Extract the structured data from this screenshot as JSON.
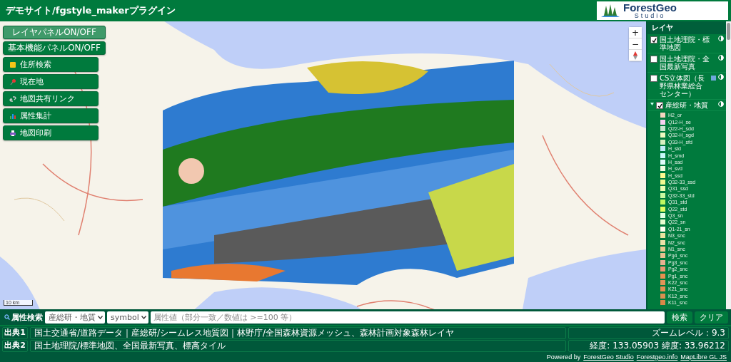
{
  "header": {
    "title": "デモサイト/fgstyle_makerプラグイン",
    "logo": {
      "name": "ForestGeo",
      "sub": "Studio"
    }
  },
  "left_buttons": [
    {
      "kind": "toggle",
      "label": "レイヤパネルON/OFF",
      "selected": true
    },
    {
      "kind": "toggle",
      "label": "基本機能パネルON/OFF",
      "selected": false
    },
    {
      "kind": "address",
      "label": "住所検索",
      "selected": false
    },
    {
      "kind": "location",
      "label": "現在地",
      "selected": false
    },
    {
      "kind": "link",
      "label": "地図共有リンク",
      "selected": false
    },
    {
      "kind": "stats",
      "label": "属性集計",
      "selected": false
    },
    {
      "kind": "print",
      "label": "地図印刷",
      "selected": false
    }
  ],
  "map": {
    "scale": "10 km",
    "controls": [
      "+",
      "−"
    ]
  },
  "layer_panel": {
    "title": "レイヤ",
    "layers": [
      {
        "name": "国土地理院・標準地図",
        "checked": true,
        "expanded": false
      },
      {
        "name": "国土地理院・全国最新写真",
        "checked": false,
        "expanded": false
      },
      {
        "name": "CS立体図（長野県林業総合センター）",
        "checked": false,
        "expanded": false,
        "color": "#6fa8dc"
      },
      {
        "name": "産総研・地質",
        "checked": true,
        "expanded": true
      }
    ],
    "legend": [
      {
        "label": "H2_or",
        "color": "#f5d5c0"
      },
      {
        "label": "Q12-H_se",
        "color": "#f7d0f0"
      },
      {
        "label": "Q22-H_sdd",
        "color": "#c8e6d0"
      },
      {
        "label": "Q32-H_sgd",
        "color": "#eef8c0"
      },
      {
        "label": "Q33-H_sfd",
        "color": "#d8f0c0"
      },
      {
        "label": "H_sld",
        "color": "#c0ecf8"
      },
      {
        "label": "H_smd",
        "color": "#c8f8f8"
      },
      {
        "label": "H_sad",
        "color": "#e0fafa"
      },
      {
        "label": "H_svd",
        "color": "#f0fce0"
      },
      {
        "label": "H_ssd",
        "color": "#fff890"
      },
      {
        "label": "Q32-33_ssd",
        "color": "#f0f890"
      },
      {
        "label": "Q31_ssd",
        "color": "#e8fcb0"
      },
      {
        "label": "Q32-33_std",
        "color": "#c8f8a0"
      },
      {
        "label": "Q31_std",
        "color": "#c0f860"
      },
      {
        "label": "Q22_std",
        "color": "#e0fc60"
      },
      {
        "label": "Q3_sn",
        "color": "#e0ffe0"
      },
      {
        "label": "Q22_sn",
        "color": "#e8fcd0"
      },
      {
        "label": "Q1-21_sn",
        "color": "#fffff0"
      },
      {
        "label": "N3_snc",
        "color": "#e8e4a0"
      },
      {
        "label": "N2_snc",
        "color": "#ece0a8"
      },
      {
        "label": "N1_snc",
        "color": "#e8c890"
      },
      {
        "label": "Pg4_snc",
        "color": "#e8c090"
      },
      {
        "label": "Pg3_snc",
        "color": "#e8b090"
      },
      {
        "label": "Pg2_snc",
        "color": "#e89870"
      },
      {
        "label": "Pg1_snc",
        "color": "#e89050"
      },
      {
        "label": "K22_snc",
        "color": "#e09458"
      },
      {
        "label": "K21_snc",
        "color": "#e09050"
      },
      {
        "label": "K12_snc",
        "color": "#d89050"
      },
      {
        "label": "K11_snc",
        "color": "#d88848"
      }
    ]
  },
  "search": {
    "label": "属性検索",
    "layer_select": "産総研・地質",
    "field_select": "symbol",
    "placeholder": "属性値（部分一致／数値は >=100 等）",
    "buttons": [
      "検索",
      "クリア"
    ]
  },
  "attribution": [
    {
      "label": "出典1",
      "text": "国土交通省/道路データ｜産総研/シームレス地質図｜林野庁/全国森林資源メッシュ、森林計画対象森林レイヤ",
      "info": "ズームレベル：9.3"
    },
    {
      "label": "出典2",
      "text": "国土地理院/標準地図、全国最新写真、標高タイル",
      "info": "経度: 133.05903 緯度: 33.96212"
    }
  ],
  "footer": {
    "prefix": "Powered by",
    "links": [
      "ForestGeo Studio",
      "Forestgeo.info",
      "MapLibre GL JS"
    ]
  }
}
